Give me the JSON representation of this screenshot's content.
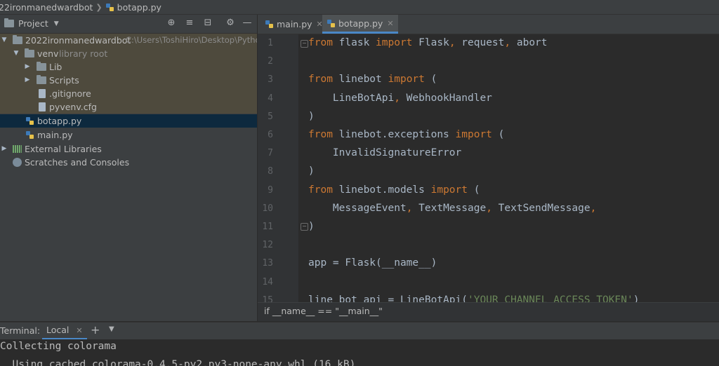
{
  "breadcrumb": {
    "project": "22ironmanedwardbot",
    "file": "botapp.py"
  },
  "project_panel": {
    "title": "Project",
    "tree": [
      {
        "label": "2022ironmanedwardbot",
        "path": "C:\\Users\\ToshiHiro\\Desktop\\Pytho",
        "icon": "folder-icon"
      },
      {
        "label": "venv",
        "note": "library root",
        "icon": "folder-icon"
      },
      {
        "label": "Lib",
        "icon": "folder-icon"
      },
      {
        "label": "Scripts",
        "icon": "folder-icon"
      },
      {
        "label": ".gitignore",
        "icon": "file-icon"
      },
      {
        "label": "pyvenv.cfg",
        "icon": "file-icon"
      },
      {
        "label": "botapp.py",
        "icon": "python-file-icon"
      },
      {
        "label": "main.py",
        "icon": "python-file-icon"
      },
      {
        "label": "External Libraries",
        "icon": "library-icon"
      },
      {
        "label": "Scratches and Consoles",
        "icon": "scratches-icon"
      }
    ]
  },
  "editor": {
    "tabs": [
      {
        "label": "main.py",
        "active": false
      },
      {
        "label": "botapp.py",
        "active": true
      }
    ],
    "line_numbers": [
      "1",
      "2",
      "3",
      "4",
      "5",
      "6",
      "7",
      "8",
      "9",
      "10",
      "11",
      "12",
      "13",
      "14",
      "15"
    ],
    "lines": [
      [
        {
          "t": "from",
          "c": "kw"
        },
        {
          "t": " flask "
        },
        {
          "t": "import",
          "c": "kw"
        },
        {
          "t": " Flask"
        },
        {
          "t": ",",
          "c": "kw"
        },
        {
          "t": " request"
        },
        {
          "t": ",",
          "c": "kw"
        },
        {
          "t": " abort"
        }
      ],
      [],
      [
        {
          "t": "from",
          "c": "kw"
        },
        {
          "t": " linebot "
        },
        {
          "t": "import",
          "c": "kw"
        },
        {
          "t": " ("
        }
      ],
      [
        {
          "t": "    LineBotApi"
        },
        {
          "t": ",",
          "c": "kw"
        },
        {
          "t": " WebhookHandler"
        }
      ],
      [
        {
          "t": ")"
        }
      ],
      [
        {
          "t": "from",
          "c": "kw"
        },
        {
          "t": " linebot.exceptions "
        },
        {
          "t": "import",
          "c": "kw"
        },
        {
          "t": " ("
        }
      ],
      [
        {
          "t": "    InvalidSignatureError"
        }
      ],
      [
        {
          "t": ")"
        }
      ],
      [
        {
          "t": "from",
          "c": "kw"
        },
        {
          "t": " linebot.models "
        },
        {
          "t": "import",
          "c": "kw"
        },
        {
          "t": " ("
        }
      ],
      [
        {
          "t": "    MessageEvent"
        },
        {
          "t": ",",
          "c": "kw"
        },
        {
          "t": " TextMessage"
        },
        {
          "t": ",",
          "c": "kw"
        },
        {
          "t": " TextSendMessage"
        },
        {
          "t": ",",
          "c": "kw"
        }
      ],
      [
        {
          "t": ")"
        }
      ],
      [],
      [
        {
          "t": "app = Flask(__name__)"
        }
      ],
      [],
      [
        {
          "t": "line_bot_api = LineBotApi("
        },
        {
          "t": "'YOUR_CHANNEL_ACCESS_TOKEN'",
          "c": "str"
        },
        {
          "t": ")"
        }
      ]
    ],
    "scope_breadcrumb": "if __name__ == \"__main__\""
  },
  "terminal": {
    "label": "Terminal:",
    "tab": "Local",
    "lines": [
      "Collecting colorama",
      "  Using cached colorama-0.4.5-py2.py3-none-any.whl (16 kB)"
    ]
  },
  "colors": {
    "keyword": "#cc7832",
    "string": "#6a8759",
    "text": "#a9b7c6",
    "selection": "#0d293e"
  }
}
